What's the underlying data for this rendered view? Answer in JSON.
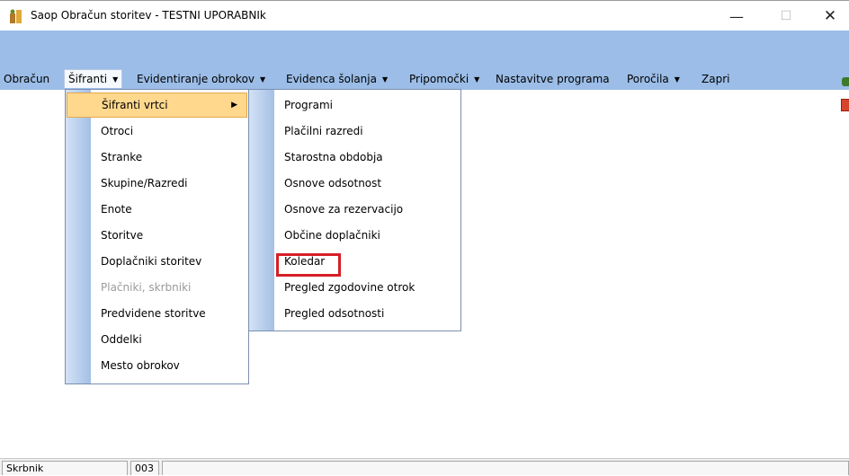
{
  "window": {
    "title": "Saop Obračun storitev - TESTNI UPORABNIk",
    "minimize_glyph": "—",
    "maximize_glyph": "☐",
    "close_glyph": "✕"
  },
  "menubar": {
    "items": [
      {
        "label": "Obračun"
      },
      {
        "label": "Šifranti"
      },
      {
        "label": "Evidentiranje obrokov"
      },
      {
        "label": "Evidenca šolanja"
      },
      {
        "label": "Pripomočki"
      },
      {
        "label": "Nastavitve programa"
      },
      {
        "label": "Poročila"
      },
      {
        "label": "Zapri"
      }
    ],
    "arrow_glyph": "▼"
  },
  "sifranti_menu": {
    "items": [
      {
        "label": "Šifranti vrtci",
        "highlighted": true,
        "has_submenu": true
      },
      {
        "label": "Otroci"
      },
      {
        "label": "Stranke"
      },
      {
        "label": "Skupine/Razredi"
      },
      {
        "label": "Enote"
      },
      {
        "label": "Storitve"
      },
      {
        "label": "Doplačniki storitev"
      },
      {
        "label": "Plačniki, skrbniki",
        "disabled": true
      },
      {
        "label": "Predvidene storitve"
      },
      {
        "label": "Oddelki"
      },
      {
        "label": "Mesto obrokov"
      }
    ],
    "submenu_arrow_glyph": "▶"
  },
  "vrtci_submenu": {
    "items": [
      {
        "label": "Programi"
      },
      {
        "label": "Plačilni razredi"
      },
      {
        "label": "Starostna obdobja"
      },
      {
        "label": "Osnove odsotnost"
      },
      {
        "label": "Osnove za rezervacijo"
      },
      {
        "label": "Občine doplačniki"
      },
      {
        "label": "Koledar",
        "outlined": true
      },
      {
        "label": "Pregled zgodovine otrok"
      },
      {
        "label": "Pregled odsotnosti"
      }
    ],
    "outline_color": "#d51f26"
  },
  "statusbar": {
    "user": "Skrbnik",
    "code": "003"
  },
  "colors": {
    "toolbar_strip": "#9bbde7",
    "highlight": "#ffd88e"
  }
}
